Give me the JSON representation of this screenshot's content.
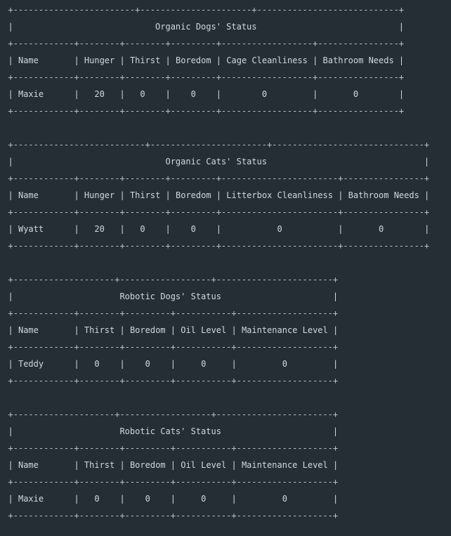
{
  "tables": [
    {
      "title": "Organic Dogs' Status",
      "headers": [
        "Name",
        "Hunger",
        "Thirst",
        "Boredom",
        "Cage Cleanliness",
        "Bathroom Needs"
      ],
      "rows": [
        [
          "Maxie",
          "20",
          "0",
          "0",
          "0",
          "0"
        ]
      ]
    },
    {
      "title": "Organic Cats' Status",
      "headers": [
        "Name",
        "Hunger",
        "Thirst",
        "Boredom",
        "Litterbox Cleanliness",
        "Bathroom Needs"
      ],
      "rows": [
        [
          "Wyatt",
          "20",
          "0",
          "0",
          "0",
          "0"
        ]
      ]
    },
    {
      "title": "Robotic Dogs' Status",
      "headers": [
        "Name",
        "Thirst",
        "Boredom",
        "Oil Level",
        "Maintenance Level"
      ],
      "rows": [
        [
          "Teddy",
          "0",
          "0",
          "0",
          "0"
        ]
      ]
    },
    {
      "title": "Robotic Cats' Status",
      "headers": [
        "Name",
        "Thirst",
        "Boredom",
        "Oil Level",
        "Maintenance Level"
      ],
      "rows": [
        [
          "Maxie",
          "0",
          "0",
          "0",
          "0"
        ]
      ]
    }
  ]
}
